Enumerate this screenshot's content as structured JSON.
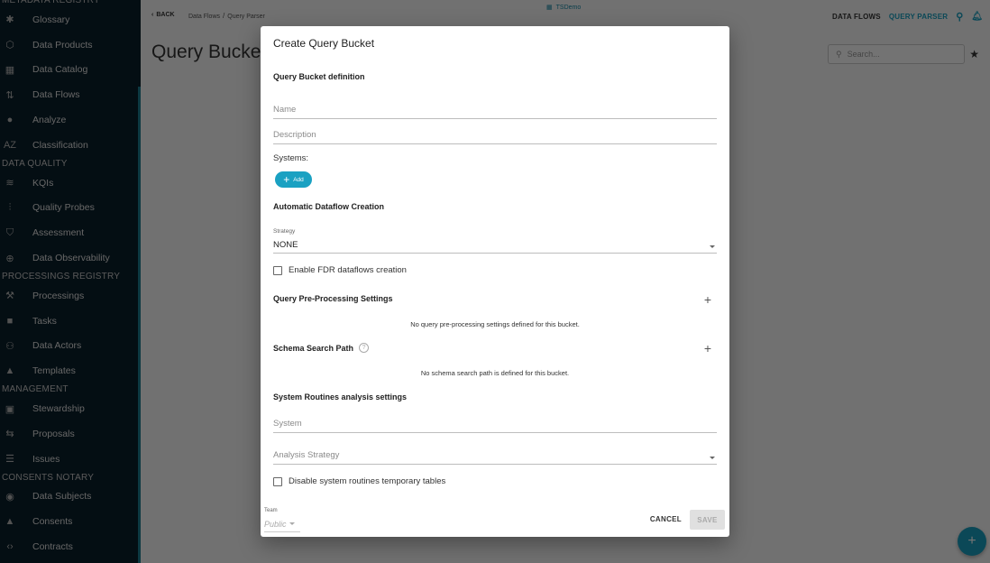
{
  "sidebar": {
    "sections": [
      {
        "title": "METADATA REGISTRY",
        "items": [
          {
            "label": "Glossary",
            "icon": "puzzle-icon"
          },
          {
            "label": "Data Products",
            "icon": "hexagon-icon"
          },
          {
            "label": "Data Catalog",
            "icon": "building-icon"
          },
          {
            "label": "Data Flows",
            "icon": "flows-icon"
          },
          {
            "label": "Analyze",
            "icon": "compass-icon"
          },
          {
            "label": "Classification",
            "icon": "az-icon"
          }
        ]
      },
      {
        "title": "DATA QUALITY",
        "items": [
          {
            "label": "KQIs",
            "icon": "wifi-icon"
          },
          {
            "label": "Quality Probes",
            "icon": "probes-icon"
          },
          {
            "label": "Assessment",
            "icon": "shield-check-icon"
          },
          {
            "label": "Data Observability",
            "icon": "observe-icon"
          }
        ]
      },
      {
        "title": "PROCESSINGS REGISTRY",
        "items": [
          {
            "label": "Processings",
            "icon": "gavel-icon"
          },
          {
            "label": "Tasks",
            "icon": "briefcase-icon"
          },
          {
            "label": "Data Actors",
            "icon": "people-icon"
          },
          {
            "label": "Templates",
            "icon": "shapes-icon"
          }
        ]
      },
      {
        "title": "MANAGEMENT",
        "items": [
          {
            "label": "Stewardship",
            "icon": "badge-icon"
          },
          {
            "label": "Proposals",
            "icon": "thumbs-icon"
          },
          {
            "label": "Issues",
            "icon": "clipboard-icon"
          }
        ]
      },
      {
        "title": "CONSENTS NOTARY",
        "items": [
          {
            "label": "Data Subjects",
            "icon": "face-icon"
          },
          {
            "label": "Consents",
            "icon": "thumb-up-icon"
          },
          {
            "label": "Contracts",
            "icon": "code-icon"
          }
        ]
      }
    ]
  },
  "topbar": {
    "back_label": "BACK",
    "breadcrumb": [
      "Data Flows",
      "Query Parser"
    ],
    "brand": "TSDemo",
    "links": [
      {
        "label": "DATA FLOWS",
        "active": false
      },
      {
        "label": "QUERY PARSER",
        "active": true
      }
    ]
  },
  "page": {
    "title": "Query Buckets",
    "search_placeholder": "Search..."
  },
  "dialog": {
    "title": "Create Query Bucket",
    "definition_heading": "Query Bucket definition",
    "name_placeholder": "Name",
    "description_placeholder": "Description",
    "systems_label": "Systems:",
    "add_label": "Add",
    "auto_heading": "Automatic Dataflow Creation",
    "strategy_label": "Strategy",
    "strategy_value": "NONE",
    "fdr_checkbox": {
      "label": "Enable FDR dataflows creation",
      "checked": false
    },
    "preproc_heading": "Query Pre-Processing Settings",
    "preproc_empty": "No query pre-processing settings defined for this bucket.",
    "schema_heading": "Schema Search Path",
    "schema_empty": "No schema search path is defined for this bucket.",
    "routines_heading": "System Routines analysis settings",
    "system_placeholder": "System",
    "analysis_placeholder": "Analysis Strategy",
    "temp_checkbox": {
      "label": "Disable system routines temporary tables",
      "checked": false
    },
    "team_label": "Team",
    "team_value": "Public",
    "cancel_label": "CANCEL",
    "save_label": "SAVE"
  },
  "colors": {
    "accent": "#1aa1c2",
    "sidebar_bg": "#0b1f2a"
  }
}
